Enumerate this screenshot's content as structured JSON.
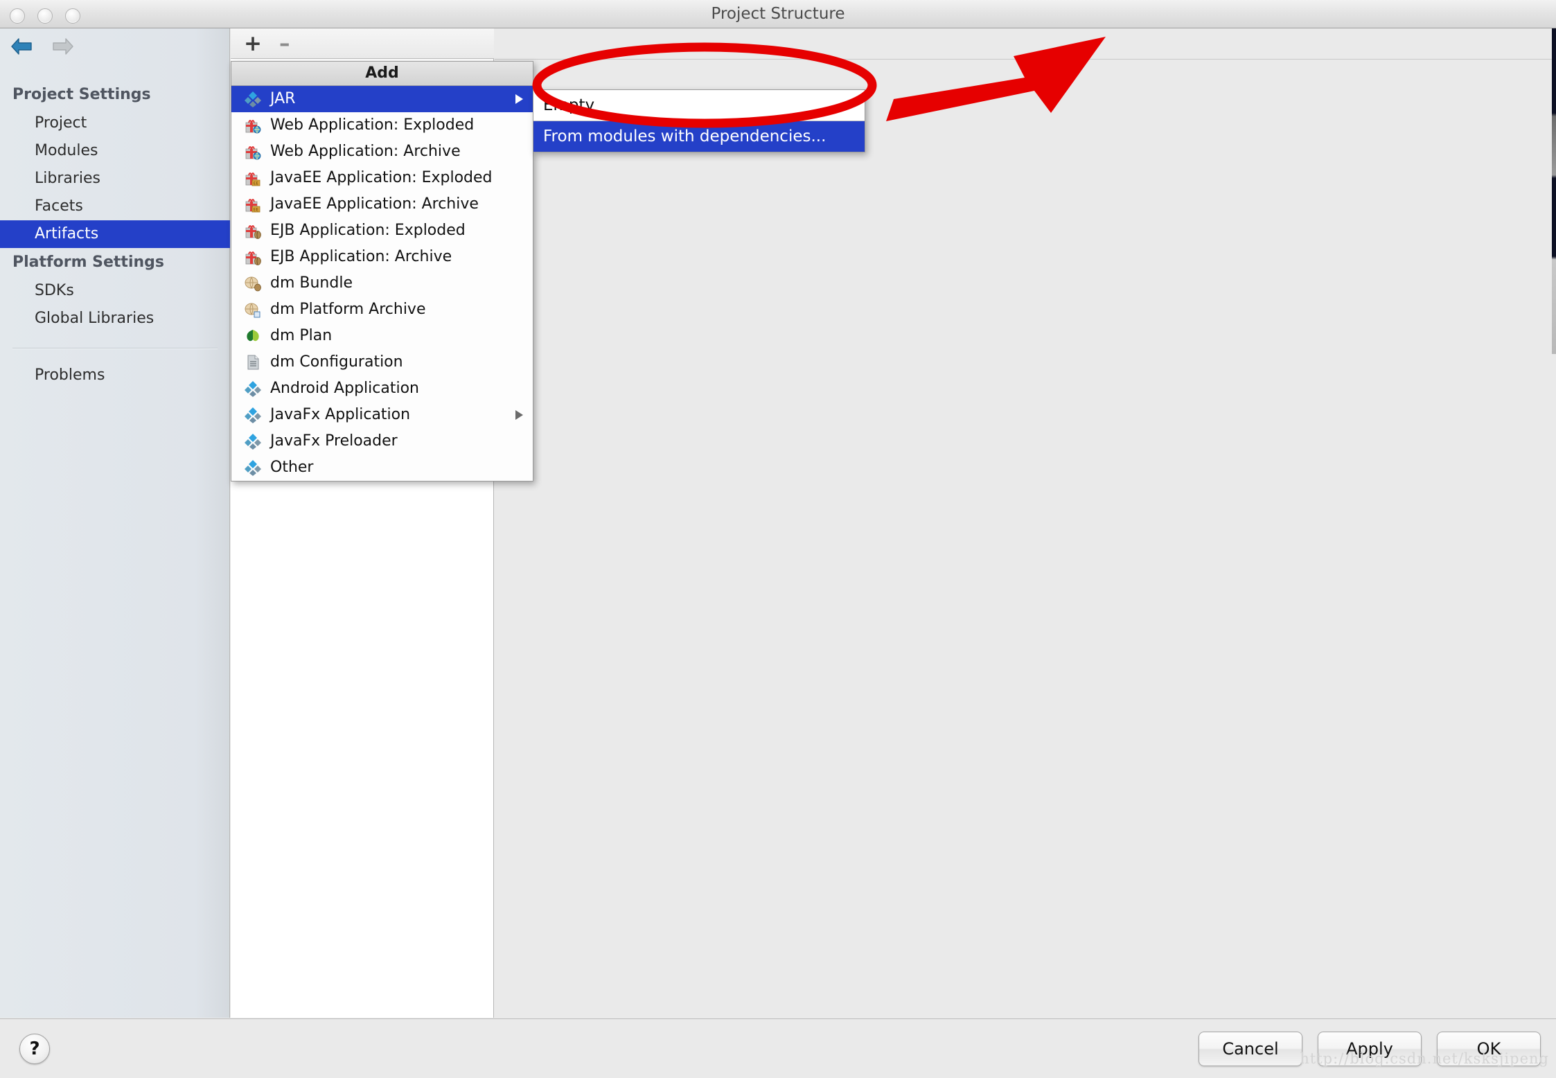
{
  "window": {
    "title": "Project Structure",
    "traffic_lights": [
      "close",
      "minimize",
      "zoom"
    ]
  },
  "sidebar": {
    "back_icon": "back-arrow-icon",
    "forward_icon": "forward-arrow-icon",
    "groups": [
      {
        "label": "Project Settings",
        "items": [
          {
            "label": "Project",
            "selected": false
          },
          {
            "label": "Modules",
            "selected": false
          },
          {
            "label": "Libraries",
            "selected": false
          },
          {
            "label": "Facets",
            "selected": false
          },
          {
            "label": "Artifacts",
            "selected": true
          }
        ]
      },
      {
        "label": "Platform Settings",
        "items": [
          {
            "label": "SDKs",
            "selected": false
          },
          {
            "label": "Global Libraries",
            "selected": false
          }
        ]
      }
    ],
    "extra_items": [
      {
        "label": "Problems",
        "selected": false
      }
    ]
  },
  "toolbar": {
    "add_label": "+",
    "remove_label": "–"
  },
  "popup": {
    "header": "Add",
    "items": [
      {
        "label": "JAR",
        "icon": "jar-diamond-icon",
        "selected": true,
        "submenu": true
      },
      {
        "label": "Web Application: Exploded",
        "icon": "gift-web-icon",
        "selected": false,
        "submenu": false
      },
      {
        "label": "Web Application: Archive",
        "icon": "gift-web-icon",
        "selected": false,
        "submenu": false
      },
      {
        "label": "JavaEE Application: Exploded",
        "icon": "gift-ee-icon",
        "selected": false,
        "submenu": false
      },
      {
        "label": "JavaEE Application: Archive",
        "icon": "gift-ee-icon",
        "selected": false,
        "submenu": false
      },
      {
        "label": "EJB Application: Exploded",
        "icon": "gift-ejb-icon",
        "selected": false,
        "submenu": false
      },
      {
        "label": "EJB Application: Archive",
        "icon": "gift-ejb-icon",
        "selected": false,
        "submenu": false
      },
      {
        "label": "dm Bundle",
        "icon": "bundle-icon",
        "selected": false,
        "submenu": false
      },
      {
        "label": "dm Platform Archive",
        "icon": "platform-archive-icon",
        "selected": false,
        "submenu": false
      },
      {
        "label": "dm Plan",
        "icon": "leaf-plan-icon",
        "selected": false,
        "submenu": false
      },
      {
        "label": "dm Configuration",
        "icon": "document-config-icon",
        "selected": false,
        "submenu": false
      },
      {
        "label": "Android Application",
        "icon": "android-diamond-icon",
        "selected": false,
        "submenu": false
      },
      {
        "label": "JavaFx Application",
        "icon": "javafx-diamond-icon",
        "selected": false,
        "submenu": true
      },
      {
        "label": "JavaFx Preloader",
        "icon": "javafx-diamond-icon",
        "selected": false,
        "submenu": false
      },
      {
        "label": "Other",
        "icon": "other-diamond-icon",
        "selected": false,
        "submenu": false
      }
    ]
  },
  "submenu": {
    "items": [
      {
        "label": "Empty",
        "selected": false
      },
      {
        "label": "From modules with dependencies...",
        "selected": true
      }
    ]
  },
  "footer": {
    "help_label": "?",
    "buttons": [
      {
        "label": "Cancel"
      },
      {
        "label": "Apply"
      },
      {
        "label": "OK"
      }
    ]
  },
  "annotation": {
    "color": "#e60000",
    "shape": "ellipse-with-arrow",
    "target": "From modules with dependencies..."
  },
  "watermark": {
    "text": "http://blog.csdn.net/ksksjipeng"
  }
}
